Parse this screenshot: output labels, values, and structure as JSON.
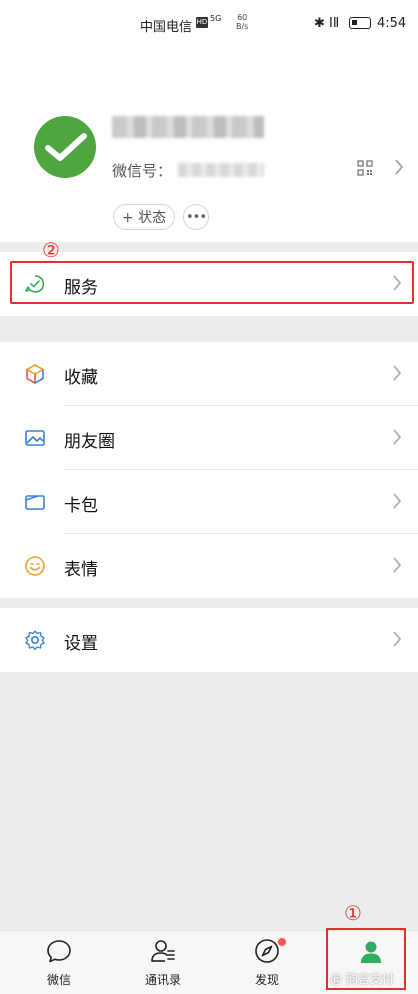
{
  "status_bar": {
    "carrier": "中国电信",
    "hd": "HD",
    "signal": "5G",
    "speed_top": "60",
    "speed_unit": "B/s",
    "icons": "✱ ⅠⅡ",
    "time": "4:54"
  },
  "profile": {
    "wechat_id_label": "微信号：",
    "status_button": "+ 状态",
    "more_button": "•••"
  },
  "annotations": {
    "step1": "①",
    "step2": "②"
  },
  "menu": {
    "services": "服务",
    "favorites": "收藏",
    "moments": "朋友圈",
    "cards": "卡包",
    "stickers": "表情",
    "settings": "设置"
  },
  "tabbar": {
    "chats": "微信",
    "contacts": "通讯录",
    "discover": "发现",
    "me": ""
  },
  "watermark": "@ 韵言支付",
  "colors": {
    "accent": "#07c160",
    "highlight": "#e0312c",
    "badge": "#fa5151"
  }
}
